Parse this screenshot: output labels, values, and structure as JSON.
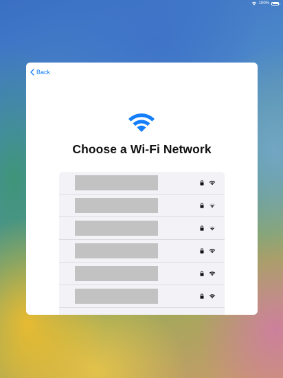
{
  "status_bar": {
    "battery_text": "100%",
    "icons": [
      "wifi-icon",
      "battery-icon"
    ]
  },
  "sheet": {
    "back_label": "Back",
    "hero_icon": "wifi-icon",
    "title": "Choose a Wi-Fi Network"
  },
  "networks": [
    {
      "name_redacted": true,
      "secured": true,
      "signal": "full"
    },
    {
      "name_redacted": true,
      "secured": true,
      "signal": "medium"
    },
    {
      "name_redacted": true,
      "secured": true,
      "signal": "medium"
    },
    {
      "name_redacted": true,
      "secured": true,
      "signal": "full"
    },
    {
      "name_redacted": true,
      "secured": true,
      "signal": "full"
    },
    {
      "name_redacted": true,
      "secured": true,
      "signal": "full"
    }
  ],
  "colors": {
    "accent": "#147efb",
    "sheet_background": "#ffffff",
    "list_background": "#f2f2f7",
    "redaction": "#c2c2c2"
  }
}
